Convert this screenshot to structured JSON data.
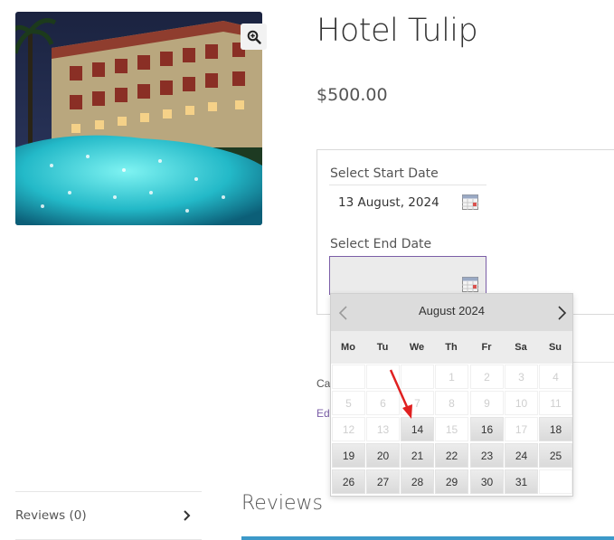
{
  "product": {
    "title": "Hotel Tulip",
    "price": "$500.00",
    "image_alt": "hotel-pool-photo"
  },
  "booking": {
    "start_label": "Select Start Date",
    "start_value": "13 August, 2024",
    "end_label": "Select End Date",
    "end_value": ""
  },
  "meta": {
    "category_partial": "Cat",
    "edit_partial": "Edi"
  },
  "datepicker": {
    "month_label": "August 2024",
    "weekdays": [
      "Mo",
      "Tu",
      "We",
      "Th",
      "Fr",
      "Sa",
      "Su"
    ],
    "rows": [
      [
        {
          "t": ""
        },
        {
          "t": ""
        },
        {
          "t": ""
        },
        {
          "t": "1",
          "s": "disabled"
        },
        {
          "t": "2",
          "s": "disabled"
        },
        {
          "t": "3",
          "s": "disabled"
        },
        {
          "t": "4",
          "s": "disabled"
        }
      ],
      [
        {
          "t": "5",
          "s": "disabled"
        },
        {
          "t": "6",
          "s": "disabled"
        },
        {
          "t": "7",
          "s": "disabled"
        },
        {
          "t": "8",
          "s": "disabled"
        },
        {
          "t": "9",
          "s": "disabled"
        },
        {
          "t": "10",
          "s": "disabled"
        },
        {
          "t": "11",
          "s": "disabled"
        }
      ],
      [
        {
          "t": "12",
          "s": "disabled"
        },
        {
          "t": "13",
          "s": "disabled"
        },
        {
          "t": "14",
          "s": "enabled"
        },
        {
          "t": "15",
          "s": "disabled"
        },
        {
          "t": "16",
          "s": "enabled"
        },
        {
          "t": "17",
          "s": "disabled"
        },
        {
          "t": "18",
          "s": "enabled"
        }
      ],
      [
        {
          "t": "19",
          "s": "enabled"
        },
        {
          "t": "20",
          "s": "enabled"
        },
        {
          "t": "21",
          "s": "enabled"
        },
        {
          "t": "22",
          "s": "enabled"
        },
        {
          "t": "23",
          "s": "enabled"
        },
        {
          "t": "24",
          "s": "enabled"
        },
        {
          "t": "25",
          "s": "enabled"
        }
      ],
      [
        {
          "t": "26",
          "s": "enabled"
        },
        {
          "t": "27",
          "s": "enabled"
        },
        {
          "t": "28",
          "s": "enabled"
        },
        {
          "t": "29",
          "s": "enabled"
        },
        {
          "t": "30",
          "s": "enabled"
        },
        {
          "t": "31",
          "s": "enabled"
        },
        {
          "t": ""
        }
      ]
    ]
  },
  "tabs": {
    "reviews_label": "Reviews (0)"
  },
  "reviews": {
    "heading": "Reviews"
  },
  "colors": {
    "accent": "#7b5ea7",
    "arrow": "#e02020",
    "reviews_bar": "#3c99c9"
  }
}
